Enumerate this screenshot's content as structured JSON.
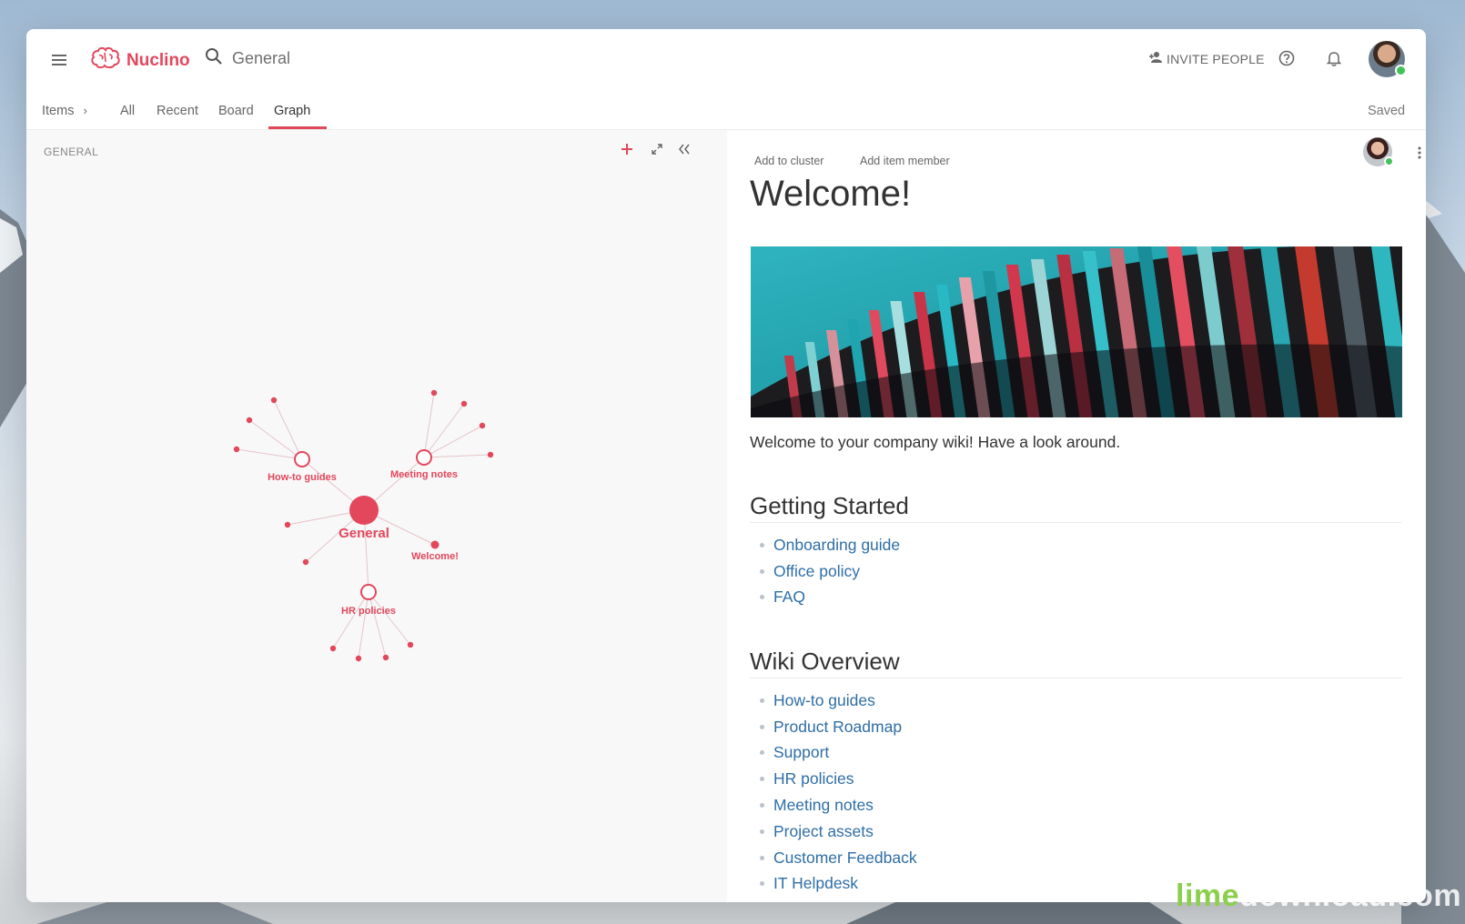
{
  "app": {
    "logo_text": "Nuclino",
    "brand_color": "#e2475c",
    "link_color": "#2f6ea6"
  },
  "topbar": {
    "menu_icon": "hamburger-icon",
    "search_placeholder": "General",
    "invite_label": "INVITE PEOPLE",
    "help_icon": "help-circle-icon",
    "bell_icon": "bell-icon"
  },
  "navbar": {
    "breadcrumb": "Items",
    "tabs": [
      {
        "label": "All"
      },
      {
        "label": "Recent"
      },
      {
        "label": "Board"
      },
      {
        "label": "Graph"
      }
    ],
    "active_tab": "Graph",
    "status": "Saved"
  },
  "left_panel": {
    "section_label": "GENERAL",
    "graph_nodes": {
      "center": "General",
      "how_to": "How-to guides",
      "meeting": "Meeting notes",
      "welcome": "Welcome!",
      "hr": "HR policies"
    }
  },
  "document": {
    "add_to_cluster": "Add to cluster",
    "add_item_member": "Add item member",
    "title": "Welcome!",
    "intro": "Welcome to your company wiki! Have a look around.",
    "getting_started": {
      "heading": "Getting Started",
      "items": [
        "Onboarding guide",
        "Office policy",
        "FAQ"
      ]
    },
    "wiki_overview": {
      "heading": "Wiki Overview",
      "items": [
        "How-to guides",
        "Product Roadmap",
        "Support",
        "HR policies",
        "Meeting notes",
        "Project assets",
        "Customer Feedback",
        "IT Helpdesk"
      ]
    }
  },
  "watermark": {
    "part1": "lime",
    "part2": "download.com"
  }
}
